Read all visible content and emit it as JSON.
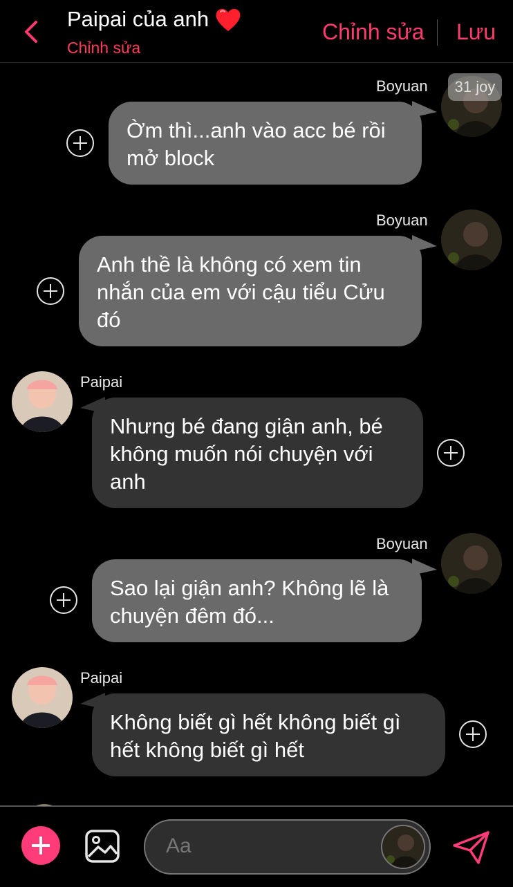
{
  "header": {
    "title": "Paipai của anh",
    "subtitle": "Chỉnh sửa",
    "edit_label": "Chỉnh sửa",
    "save_label": "Lưu",
    "heart_icon": "red-heart-icon",
    "accent": "#ff3b6e"
  },
  "time_badge": "31 joy",
  "messages": [
    {
      "sender": "Boyuan",
      "side": "sent",
      "text": "Ờm thì...anh vào acc bé rồi mở block"
    },
    {
      "sender": "Boyuan",
      "side": "sent",
      "text": "Anh thề là không có xem tin nhắn của em với cậu tiểu Cửu đó"
    },
    {
      "sender": "Paipai",
      "side": "received",
      "text": "Nhưng bé đang giận anh, bé không muốn nói chuyện với anh"
    },
    {
      "sender": "Boyuan",
      "side": "sent",
      "text": "Sao lại giận anh? Không lẽ là chuyện đêm đó..."
    },
    {
      "sender": "Paipai",
      "side": "received",
      "text": "Không biết gì hết không biết gì hết không biết gì hết"
    }
  ],
  "composer": {
    "placeholder": "Aa",
    "icons": [
      "plus-icon",
      "image-icon",
      "send-icon"
    ]
  },
  "colors": {
    "background": "#000000",
    "sent_bubble": "#6a6a6a",
    "received_bubble": "#333333",
    "accent": "#ff3b7a"
  }
}
